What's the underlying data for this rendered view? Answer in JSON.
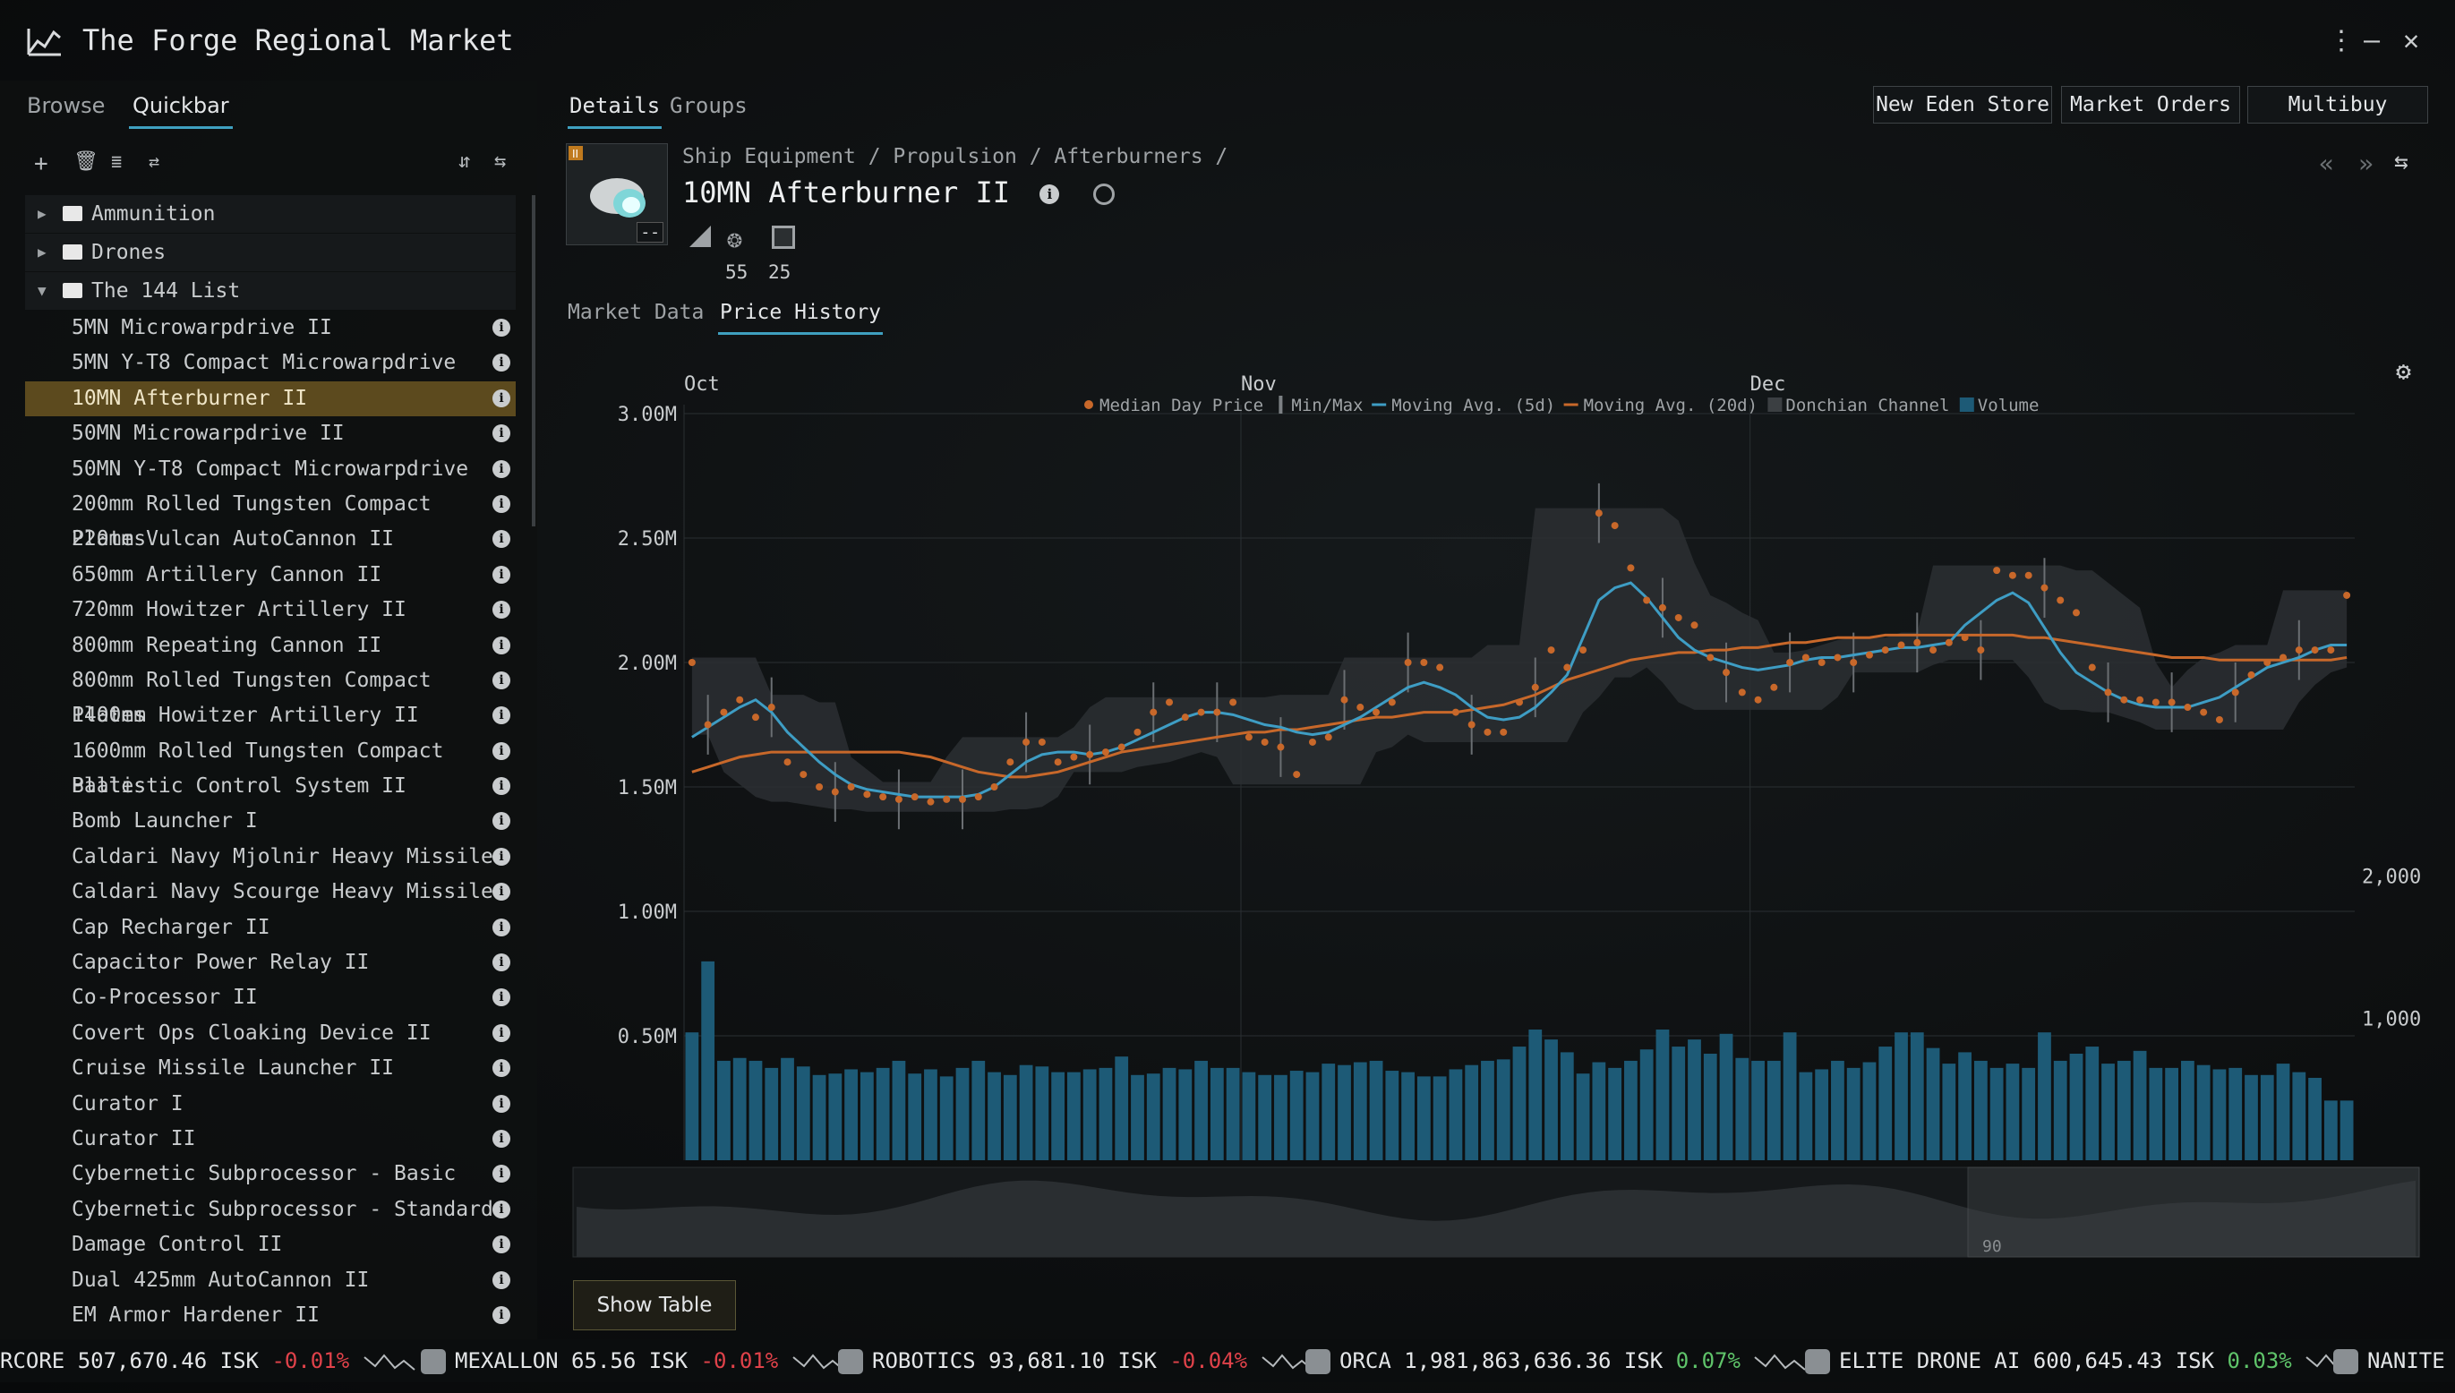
{
  "window": {
    "title": "The Forge Regional Market"
  },
  "left": {
    "tabs": [
      "Browse",
      "Quickbar"
    ],
    "folders": [
      {
        "label": "Ammunition",
        "expanded": false
      },
      {
        "label": "Drones",
        "expanded": false
      },
      {
        "label": "The 144 List",
        "expanded": true
      }
    ],
    "items": [
      "5MN Microwarpdrive II",
      "5MN Y-T8 Compact Microwarpdrive",
      "10MN Afterburner II",
      "50MN Microwarpdrive II",
      "50MN Y-T8 Compact Microwarpdrive",
      "200mm Rolled Tungsten Compact Plates",
      "220mm Vulcan AutoCannon II",
      "650mm Artillery Cannon II",
      "720mm Howitzer Artillery II",
      "800mm Repeating Cannon II",
      "800mm Rolled Tungsten Compact Plates",
      "1400mm Howitzer Artillery II",
      "1600mm Rolled Tungsten Compact Plates",
      "Ballistic Control System II",
      "Bomb Launcher I",
      "Caldari Navy Mjolnir Heavy Missile",
      "Caldari Navy Scourge Heavy Missile",
      "Cap Recharger II",
      "Capacitor Power Relay II",
      "Co-Processor II",
      "Covert Ops Cloaking Device II",
      "Cruise Missile Launcher II",
      "Curator I",
      "Curator II",
      "Cybernetic Subprocessor - Basic",
      "Cybernetic Subprocessor - Standard",
      "Damage Control II",
      "Dual 425mm AutoCannon II",
      "EM Armor Hardener II"
    ],
    "selected_index": 2
  },
  "right": {
    "tabs": [
      "Details",
      "Groups"
    ],
    "buttons": [
      "New Eden Store",
      "Market Orders",
      "Multibuy"
    ],
    "breadcrumb": "Ship Equipment / Propulsion / Afterburners /",
    "item_name": "10MN Afterburner II",
    "attr_values": [
      "55",
      "25"
    ],
    "icon_badge": "--",
    "subtabs": [
      "Market Data",
      "Price History"
    ],
    "show_table": "Show Table",
    "navigator_label": "90"
  },
  "chart_data": {
    "type": "line",
    "months": [
      "Oct",
      "Nov",
      "Dec"
    ],
    "legend": [
      "Median Day Price",
      "Min/Max",
      "Moving Avg. (5d)",
      "Moving Avg. (20d)",
      "Donchian Channel",
      "Volume"
    ],
    "y_ticks": [
      "3.00M",
      "2.50M",
      "2.00M",
      "1.50M",
      "1.00M",
      "0.50M"
    ],
    "ylim": [
      0,
      3000000
    ],
    "volume_ticks": [
      "2,000",
      "1,000"
    ],
    "volume_lim": [
      0,
      3000
    ],
    "series": [
      {
        "name": "Median Day Price",
        "color": "#c8682a",
        "values": [
          2.0,
          1.75,
          1.8,
          1.85,
          1.78,
          1.82,
          1.6,
          1.55,
          1.5,
          1.48,
          1.5,
          1.47,
          1.46,
          1.45,
          1.46,
          1.44,
          1.45,
          1.45,
          1.46,
          1.5,
          1.6,
          1.68,
          1.68,
          1.6,
          1.62,
          1.63,
          1.64,
          1.66,
          1.72,
          1.8,
          1.84,
          1.78,
          1.8,
          1.8,
          1.84,
          1.7,
          1.68,
          1.66,
          1.55,
          1.68,
          1.7,
          1.85,
          1.82,
          1.8,
          1.84,
          2.0,
          2.0,
          1.98,
          1.8,
          1.75,
          1.72,
          1.72,
          1.84,
          1.9,
          2.05,
          1.98,
          2.05,
          2.6,
          2.55,
          2.38,
          2.25,
          2.22,
          2.18,
          2.15,
          2.02,
          1.96,
          1.88,
          1.85,
          1.9,
          2.0,
          2.02,
          2.0,
          2.02,
          2.0,
          2.03,
          2.05,
          2.07,
          2.08,
          2.05,
          2.08,
          2.1,
          2.05,
          2.37,
          2.35,
          2.35,
          2.3,
          2.25,
          2.2,
          1.98,
          1.88,
          1.85,
          1.85,
          1.84,
          1.84,
          1.82,
          1.8,
          1.77,
          1.88,
          1.95,
          2.0,
          2.02,
          2.05,
          2.05,
          2.05,
          2.27
        ]
      },
      {
        "name": "Moving Avg. (5d)",
        "color": "#3e9dc4",
        "values": [
          1.7,
          1.74,
          1.78,
          1.82,
          1.85,
          1.8,
          1.72,
          1.66,
          1.6,
          1.55,
          1.51,
          1.49,
          1.48,
          1.47,
          1.46,
          1.46,
          1.46,
          1.46,
          1.47,
          1.5,
          1.55,
          1.6,
          1.63,
          1.64,
          1.64,
          1.63,
          1.64,
          1.66,
          1.69,
          1.72,
          1.75,
          1.78,
          1.8,
          1.8,
          1.79,
          1.77,
          1.75,
          1.74,
          1.72,
          1.71,
          1.72,
          1.75,
          1.78,
          1.82,
          1.86,
          1.9,
          1.92,
          1.9,
          1.87,
          1.82,
          1.78,
          1.77,
          1.78,
          1.82,
          1.88,
          1.95,
          2.1,
          2.25,
          2.3,
          2.32,
          2.26,
          2.18,
          2.1,
          2.05,
          2.02,
          2.0,
          1.98,
          1.97,
          1.98,
          1.99,
          2.01,
          2.02,
          2.02,
          2.03,
          2.04,
          2.05,
          2.06,
          2.06,
          2.07,
          2.08,
          2.15,
          2.2,
          2.25,
          2.28,
          2.24,
          2.14,
          2.04,
          1.96,
          1.92,
          1.88,
          1.85,
          1.83,
          1.82,
          1.82,
          1.82,
          1.84,
          1.86,
          1.9,
          1.94,
          1.98,
          2.0,
          2.02,
          2.05,
          2.07,
          2.07
        ]
      },
      {
        "name": "Moving Avg. (20d)",
        "color": "#c8682a",
        "values": [
          1.56,
          1.58,
          1.6,
          1.62,
          1.63,
          1.64,
          1.64,
          1.64,
          1.64,
          1.64,
          1.64,
          1.64,
          1.64,
          1.64,
          1.63,
          1.62,
          1.6,
          1.58,
          1.56,
          1.55,
          1.54,
          1.54,
          1.55,
          1.56,
          1.58,
          1.6,
          1.62,
          1.64,
          1.65,
          1.66,
          1.67,
          1.68,
          1.69,
          1.7,
          1.71,
          1.72,
          1.72,
          1.73,
          1.73,
          1.74,
          1.75,
          1.76,
          1.77,
          1.78,
          1.78,
          1.79,
          1.8,
          1.8,
          1.8,
          1.81,
          1.82,
          1.83,
          1.85,
          1.87,
          1.9,
          1.93,
          1.95,
          1.97,
          1.99,
          2.01,
          2.02,
          2.03,
          2.04,
          2.04,
          2.05,
          2.05,
          2.06,
          2.06,
          2.07,
          2.08,
          2.08,
          2.09,
          2.1,
          2.1,
          2.1,
          2.11,
          2.11,
          2.11,
          2.11,
          2.11,
          2.11,
          2.11,
          2.11,
          2.11,
          2.1,
          2.1,
          2.09,
          2.08,
          2.07,
          2.06,
          2.05,
          2.04,
          2.03,
          2.02,
          2.02,
          2.02,
          2.01,
          2.01,
          2.01,
          2.01,
          2.01,
          2.01,
          2.01,
          2.01,
          2.02
        ]
      },
      {
        "name": "Volume",
        "color": "#1d5a76",
        "values": [
          900,
          1400,
          700,
          720,
          700,
          650,
          720,
          660,
          600,
          610,
          640,
          620,
          650,
          700,
          610,
          640,
          590,
          650,
          700,
          620,
          600,
          670,
          660,
          620,
          620,
          640,
          650,
          730,
          600,
          610,
          650,
          640,
          700,
          650,
          650,
          620,
          600,
          600,
          630,
          620,
          680,
          670,
          690,
          700,
          630,
          620,
          590,
          590,
          640,
          670,
          700,
          710,
          800,
          920,
          850,
          760,
          610,
          690,
          650,
          700,
          780,
          920,
          800,
          850,
          750,
          890,
          720,
          700,
          700,
          900,
          620,
          640,
          700,
          650,
          690,
          800,
          900,
          900,
          790,
          680,
          760,
          700,
          650,
          680,
          650,
          900,
          700,
          750,
          800,
          680,
          700,
          770,
          650,
          650,
          700,
          670,
          640,
          650,
          600,
          600,
          680,
          620,
          580,
          420,
          420
        ]
      }
    ]
  },
  "ticker": [
    {
      "name": "RCORE",
      "price": "507,670.46 ISK",
      "change": "-0.01%",
      "dir": "neg"
    },
    {
      "name": "MEXALLON",
      "price": "65.56 ISK",
      "change": "-0.01%",
      "dir": "neg"
    },
    {
      "name": "ROBOTICS",
      "price": "93,681.10 ISK",
      "change": "-0.04%",
      "dir": "neg"
    },
    {
      "name": "ORCA",
      "price": "1,981,863,636.36 ISK",
      "change": "0.07%",
      "dir": "pos"
    },
    {
      "name": "ELITE DRONE AI",
      "price": "600,645.43 ISK",
      "change": "0.03%",
      "dir": "pos"
    },
    {
      "name": "NANITE",
      "price": "",
      "change": "",
      "dir": "pos"
    }
  ]
}
